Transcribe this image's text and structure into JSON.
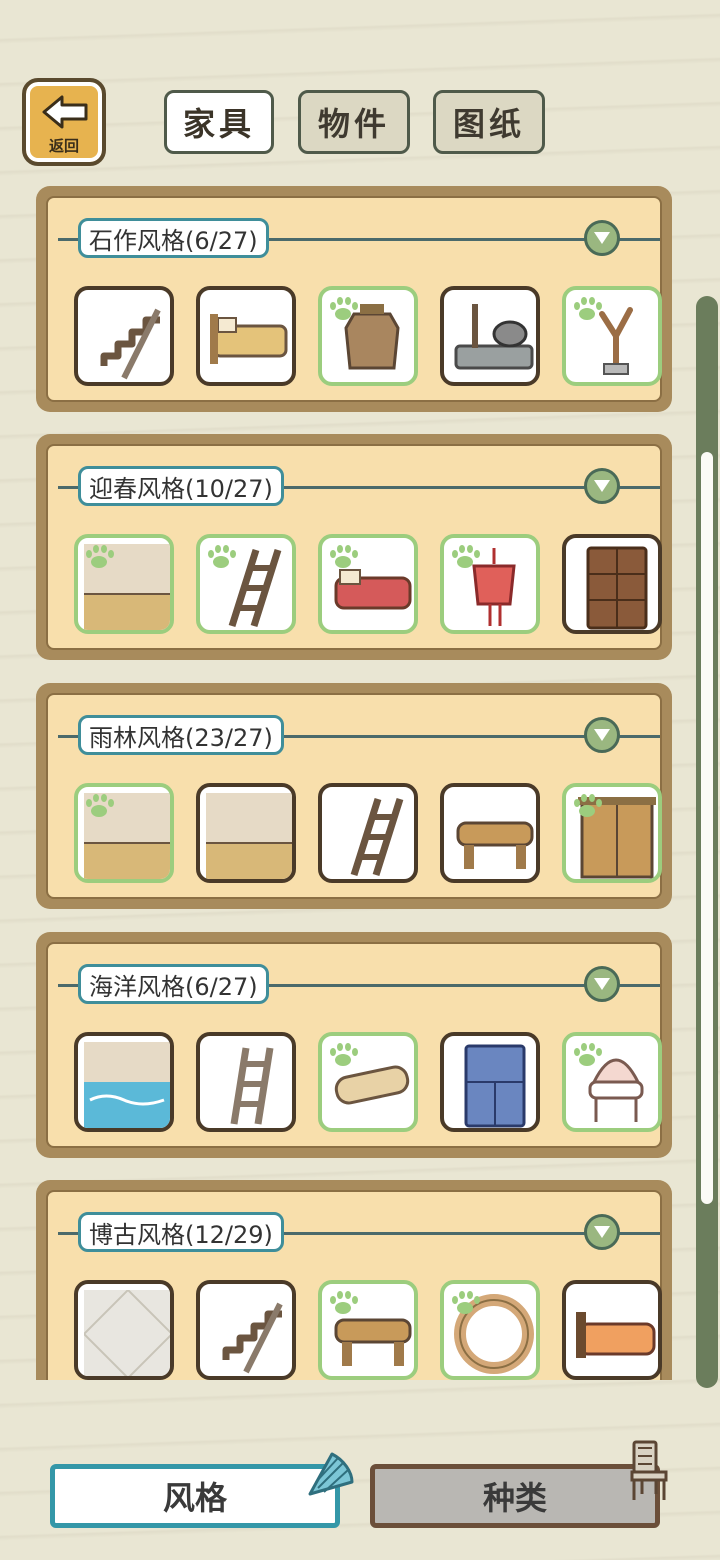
{
  "back": {
    "label": "返回"
  },
  "top_tabs": [
    {
      "label": "家具",
      "active": true
    },
    {
      "label": "物件",
      "active": false
    },
    {
      "label": "图纸",
      "active": false
    }
  ],
  "categories": [
    {
      "title": "石作风格(6/27)",
      "items": [
        {
          "icon": "stairs-icon",
          "owned": false
        },
        {
          "icon": "bed-icon",
          "owned": false
        },
        {
          "icon": "pottery-jar-icon",
          "owned": true
        },
        {
          "icon": "stone-stove-icon",
          "owned": false
        },
        {
          "icon": "branch-stand-icon",
          "owned": true
        }
      ]
    },
    {
      "title": "迎春风格(10/27)",
      "items": [
        {
          "icon": "floor-wall-icon",
          "owned": true
        },
        {
          "icon": "ladder-icon",
          "owned": true
        },
        {
          "icon": "red-bed-icon",
          "owned": true
        },
        {
          "icon": "red-charm-icon",
          "owned": true
        },
        {
          "icon": "cabinet-icon",
          "owned": false
        }
      ]
    },
    {
      "title": "雨林风格(23/27)",
      "items": [
        {
          "icon": "floor-wall-icon",
          "owned": true
        },
        {
          "icon": "floor-wall-icon",
          "owned": false
        },
        {
          "icon": "ladder-icon",
          "owned": false
        },
        {
          "icon": "log-bench-icon",
          "owned": false
        },
        {
          "icon": "wardrobe-icon",
          "owned": true
        }
      ]
    },
    {
      "title": "海洋风格(6/27)",
      "items": [
        {
          "icon": "pool-floor-icon",
          "owned": false
        },
        {
          "icon": "white-ladder-icon",
          "owned": false
        },
        {
          "icon": "scroll-map-icon",
          "owned": true
        },
        {
          "icon": "blue-cabinet-icon",
          "owned": false
        },
        {
          "icon": "shell-chair-icon",
          "owned": true
        }
      ]
    },
    {
      "title": "博古风格(12/29)",
      "items": [
        {
          "icon": "tile-floor-icon",
          "owned": false
        },
        {
          "icon": "stairs-icon",
          "owned": false
        },
        {
          "icon": "log-bench-icon",
          "owned": true
        },
        {
          "icon": "ring-icon",
          "owned": true
        },
        {
          "icon": "orange-bed-icon",
          "owned": false
        }
      ]
    }
  ],
  "bottom_tabs": [
    {
      "label": "风格",
      "active": true
    },
    {
      "label": "种类",
      "active": false
    }
  ],
  "colors": {
    "background": "#e9e6d3",
    "panel_frame": "#a88b5c",
    "panel_fill": "#f8dfac",
    "owned_border": "#9ccd7e",
    "accent_teal": "#3497a8"
  }
}
